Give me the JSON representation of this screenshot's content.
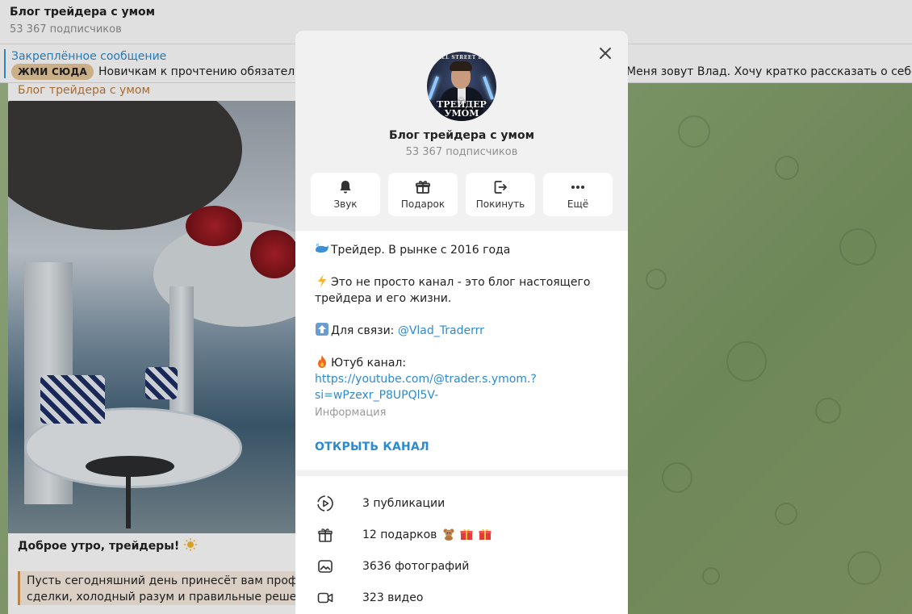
{
  "channel": {
    "title": "Блог трейдера с умом",
    "subscribers": "53 367 подписчиков"
  },
  "pinned": {
    "label": "Закреплённое сообщение",
    "button": "ЖМИ СЮДА",
    "text_left": "Новичкам к прочтению обязательн",
    "text_right": "Меня зовут Влад. Хочу кратко рассказать о себе..."
  },
  "message": {
    "author": "Блог трейдера с умом",
    "caption": "Доброе утро, трейдеры!",
    "quote_line1": "Пусть сегодняшний день принесёт вам профитн",
    "quote_line2": "сделки, холодный разум и правильные решения"
  },
  "modal": {
    "avatar_topline": "WALL STREET BOY",
    "avatar_brand_line1": "ТРЕЙДЕР",
    "avatar_brand_line2": "УМОМ",
    "actions": [
      {
        "label": "Звук",
        "icon": "bell-icon"
      },
      {
        "label": "Подарок",
        "icon": "gift-icon"
      },
      {
        "label": "Покинуть",
        "icon": "leave-icon"
      },
      {
        "label": "Ещё",
        "icon": "more-icon"
      }
    ],
    "description": {
      "line1": "Трейдер. В рынке с 2016 года",
      "line2a": "Это не просто канал - это блог настоящего",
      "line2b": "трейдера и его жизни.",
      "line3_prefix": "Для связи: ",
      "line3_link": "@Vlad_Traderrr",
      "line4": "Ютуб канал:",
      "youtube_a": "https://youtube.com/@trader.s.ymom.?",
      "youtube_b": "si=wPzexr_P8UPQl5V-",
      "info_label": "Информация"
    },
    "open_channel": "ОТКРЫТЬ КАНАЛ",
    "stats": [
      {
        "text": "3 публикации",
        "icon": "stories-icon"
      },
      {
        "text": "12 подарков",
        "icon": "gift-box-icon"
      },
      {
        "text": "3636 фотографий",
        "icon": "photo-icon"
      },
      {
        "text": "323 видео",
        "icon": "video-icon"
      }
    ]
  },
  "colors": {
    "link": "#2b8bd1",
    "author": "#c07a36",
    "quote_border": "#d59751"
  }
}
